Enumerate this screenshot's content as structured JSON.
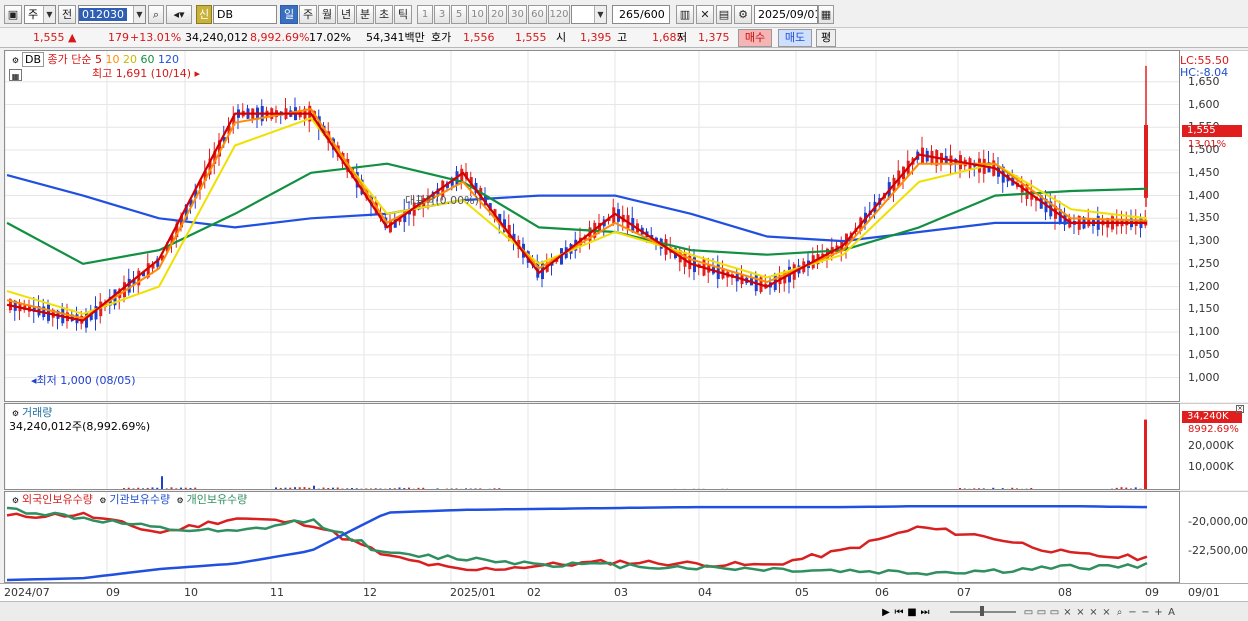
{
  "toolbar": {
    "mode": "주",
    "prev": "전",
    "code": "012030",
    "stock_name": "DB",
    "credit_badge": "신",
    "periods": [
      "일",
      "주",
      "월",
      "년",
      "분",
      "초",
      "틱"
    ],
    "active_period": "일",
    "minutes": [
      "1",
      "3",
      "5",
      "10",
      "20",
      "30",
      "60",
      "120"
    ],
    "count": "265",
    "max_count": "/600",
    "date": "2025/09/01"
  },
  "quote": {
    "price": "1,555",
    "price_arrow": "▲",
    "change": "179",
    "change_pct": "+13.01%",
    "volume": "34,240,012",
    "vol_ratio": "8,992.69%",
    "turnover": "17.02%",
    "amount": "54,341백만",
    "ask_label": "호가",
    "ask1": "1,556",
    "ask2": "1,555",
    "open_label": "시",
    "open": "1,395",
    "high_label": "고",
    "high": "1,685",
    "low_label": "저",
    "low": "1,375",
    "buy": "매수",
    "sell": "매도",
    "eval": "평"
  },
  "price_chart": {
    "name": "DB",
    "ma_label": "종가 단순",
    "ma_periods": [
      "5",
      "10",
      "20",
      "60",
      "120"
    ],
    "max_note": "최고 1,691 (10/14)",
    "min_note": "최저 1,000 (08/05)",
    "watermark": "대표락(0.00%)",
    "lc": "LC:55.50",
    "hc": "HC:-8.04",
    "last_price": "1,555",
    "last_pct": "13.01%",
    "yticks": [
      "1,650",
      "1,600",
      "1,550",
      "1,500",
      "1,450",
      "1,400",
      "1,350",
      "1,300",
      "1,250",
      "1,200",
      "1,150",
      "1,100",
      "1,050",
      "1,000"
    ],
    "colors": {
      "up": "#e02020",
      "down": "#1f3fd0",
      "ma5": "#d40000",
      "ma10": "#ff8c00",
      "ma20": "#f0e000",
      "ma60": "#109040",
      "ma120": "#2050e0"
    }
  },
  "chart_data": [
    {
      "type": "line",
      "title": "DB",
      "xlabel": "",
      "ylabel": "",
      "ylim": [
        960,
        1700
      ],
      "x": [
        "2024/07",
        "09",
        "10",
        "11",
        "12",
        "2025/01",
        "02",
        "03",
        "04",
        "05",
        "06",
        "07",
        "08",
        "09"
      ],
      "series": [
        {
          "name": "5",
          "values": [
            1160,
            1125,
            1260,
            1580,
            1580,
            1330,
            1450,
            1230,
            1360,
            1250,
            1200,
            1290,
            1490,
            1460,
            1340,
            1340
          ]
        },
        {
          "name": "10",
          "values": [
            1170,
            1130,
            1240,
            1560,
            1590,
            1340,
            1430,
            1240,
            1340,
            1260,
            1210,
            1280,
            1470,
            1470,
            1350,
            1345
          ]
        },
        {
          "name": "20",
          "values": [
            1190,
            1140,
            1200,
            1510,
            1570,
            1360,
            1390,
            1250,
            1320,
            1270,
            1220,
            1270,
            1430,
            1470,
            1370,
            1350
          ]
        },
        {
          "name": "60",
          "values": [
            1340,
            1250,
            1280,
            1360,
            1450,
            1470,
            1430,
            1330,
            1320,
            1280,
            1270,
            1280,
            1330,
            1400,
            1410,
            1415
          ]
        },
        {
          "name": "120",
          "values": [
            1445,
            1400,
            1350,
            1330,
            1350,
            1360,
            1390,
            1400,
            1400,
            1360,
            1310,
            1300,
            1320,
            1340,
            1340,
            1340
          ]
        }
      ]
    },
    {
      "type": "bar",
      "title": "거래량",
      "value_label": "34,240,012주(8,992.69%)",
      "yticks": [
        "20,000K",
        "10,000K"
      ],
      "last_volume": "34,240K",
      "last_ratio": "8992.69%",
      "ylim": [
        0,
        36000
      ],
      "values_k": [
        300,
        400,
        8000,
        500,
        5000,
        2000,
        900,
        400,
        300,
        600,
        300,
        400,
        300,
        1200,
        500,
        34240
      ]
    },
    {
      "type": "line",
      "title": "보유수량",
      "ylim": [
        -23500,
        -19000
      ],
      "yticks": [
        "-20,000,000",
        "-22,500,000"
      ],
      "series": [
        {
          "name": "외국인보유수량",
          "values": [
            -20000,
            -19900,
            -20900,
            -20100,
            -20400,
            -22200,
            -23000,
            -22700,
            -22500,
            -22600,
            -22700,
            -21900,
            -20600,
            -21200,
            -22100,
            -22300
          ]
        },
        {
          "name": "기관보유수량",
          "values": [
            -19600,
            -20100,
            -20700,
            -20900,
            -20200,
            -22100,
            -22300,
            -22600,
            -22700,
            -22800,
            -22900,
            -23000,
            -23100,
            -23000,
            -22800,
            -22700
          ]
        },
        {
          "name": "개인보유수량",
          "values": [
            -23500,
            -23400,
            -22900,
            -22600,
            -21900,
            -19800,
            -19650,
            -19600,
            -19550,
            -19500,
            -19500,
            -19500,
            -19450,
            -19450,
            -19450,
            -19500
          ]
        }
      ]
    }
  ],
  "volume_panel": {
    "title": "거래량",
    "value": "34,240,012주(8,992.69%)",
    "yticks": [
      "20,000K",
      "10,000K"
    ],
    "last": "34,240K",
    "last_pct": "8992.69%"
  },
  "holdings_panel": {
    "legend": [
      "외국인보유수량",
      "기관보유수량",
      "개인보유수량"
    ],
    "yticks": [
      "-20,000,000",
      "-22,500,000"
    ]
  },
  "xaxis": {
    "labels": [
      "2024/07",
      "09",
      "10",
      "11",
      "12",
      "2025/01",
      "02",
      "03",
      "04",
      "05",
      "06",
      "07",
      "08",
      "09"
    ],
    "right_label": "09/01"
  }
}
